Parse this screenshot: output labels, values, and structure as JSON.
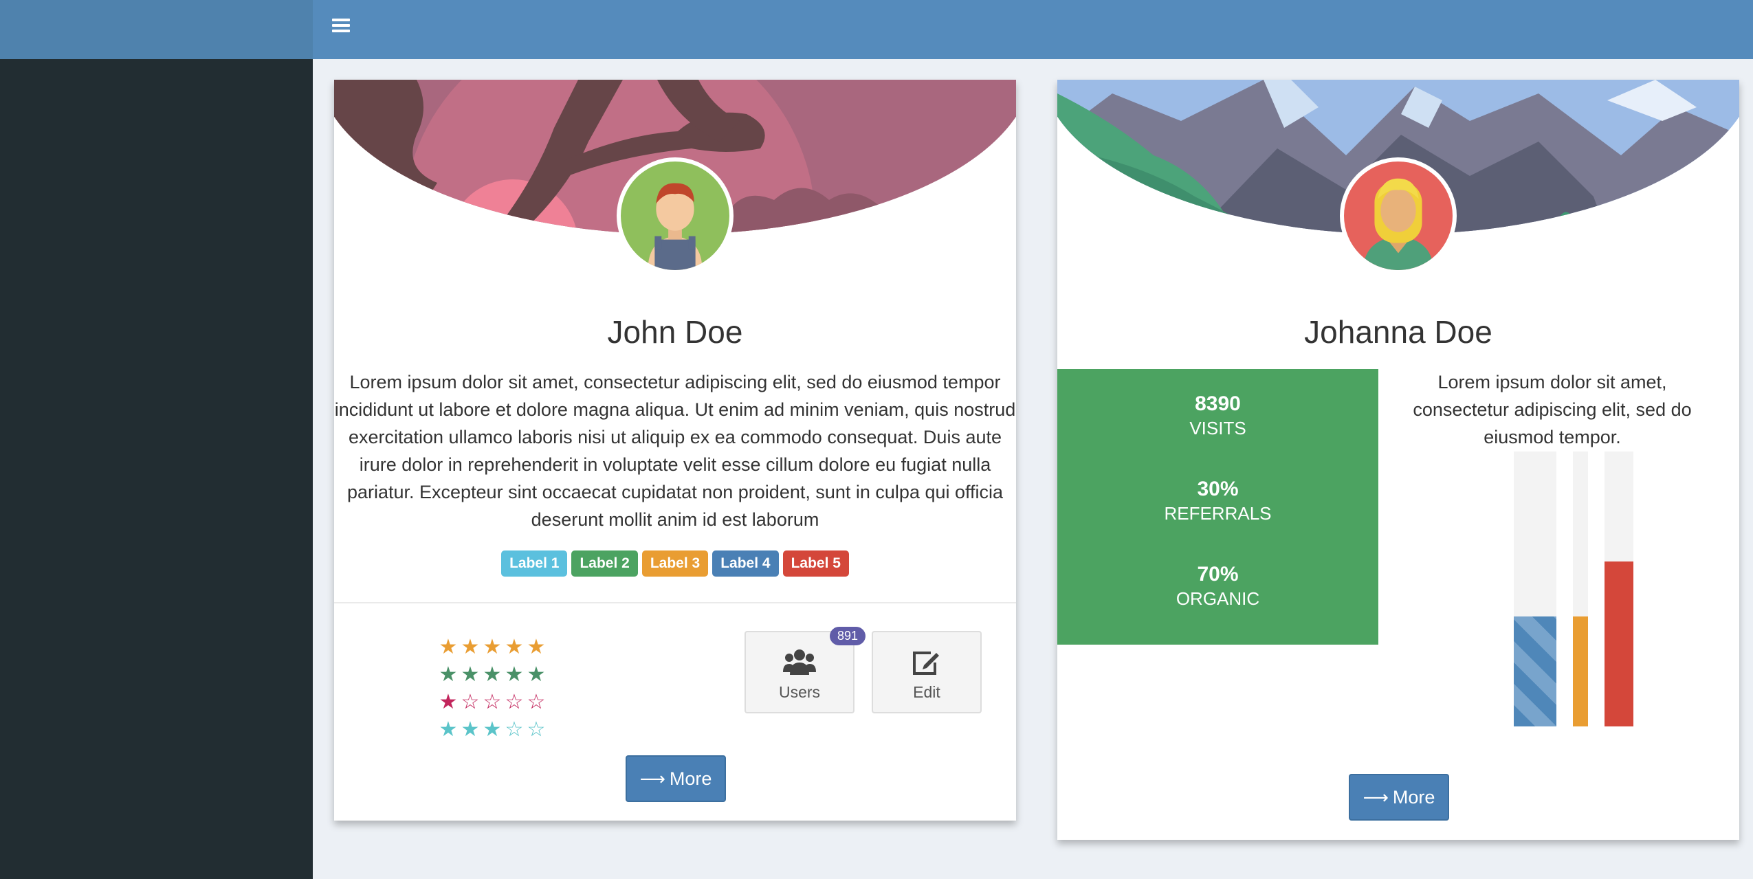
{
  "card1": {
    "name": "John Doe",
    "bio": "Lorem ipsum dolor sit amet, consectetur adipiscing elit, sed do eiusmod tempor incididunt ut labore et dolore magna aliqua. Ut enim ad minim veniam, quis nostrud exercitation ullamco laboris nisi ut aliquip ex ea commodo consequat. Duis aute irure dolor in reprehenderit in voluptate velit esse cillum dolore eu fugiat nulla pariatur. Excepteur sint occaecat cupidatat non proident, sunt in culpa qui officia deserunt mollit anim id est laborum",
    "labels": [
      {
        "text": "Label 1",
        "color": "#5bc0de"
      },
      {
        "text": "Label 2",
        "color": "#4ca361"
      },
      {
        "text": "Label 3",
        "color": "#e99d32"
      },
      {
        "text": "Label 4",
        "color": "#4a80b5"
      },
      {
        "text": "Label 5",
        "color": "#d4473a"
      }
    ],
    "ratings": [
      {
        "value": 5,
        "max": 5,
        "color": "#e99d32"
      },
      {
        "value": 5,
        "max": 5,
        "color": "#4a9168"
      },
      {
        "value": 1,
        "max": 5,
        "color": "#c2255c"
      },
      {
        "value": 3,
        "max": 5,
        "color": "#5bc4c9"
      }
    ],
    "users_button": {
      "label": "Users",
      "badge": "891",
      "icon": "users-icon"
    },
    "edit_button": {
      "label": "Edit",
      "icon": "edit-icon"
    },
    "more_label": "More"
  },
  "card2": {
    "name": "Johanna Doe",
    "stats": [
      {
        "value": "8390",
        "label": "VISITS"
      },
      {
        "value": "30%",
        "label": "REFERRALS"
      },
      {
        "value": "70%",
        "label": "ORGANIC"
      }
    ],
    "side_text": "Lorem ipsum dolor sit amet, consectetur adipiscing elit, sed do eiusmod tempor.",
    "progress_bars": [
      {
        "value": 0.4,
        "color": "#4f87b9",
        "striped": true
      },
      {
        "value": 0.4,
        "color": "#e99d32",
        "striped": false
      },
      {
        "value": 0.6,
        "color": "#d4473a",
        "striped": false
      }
    ],
    "more_label": "More"
  },
  "colors": {
    "header": "#558bbc",
    "sidebar": "#222d32",
    "background": "#ecf0f5"
  }
}
